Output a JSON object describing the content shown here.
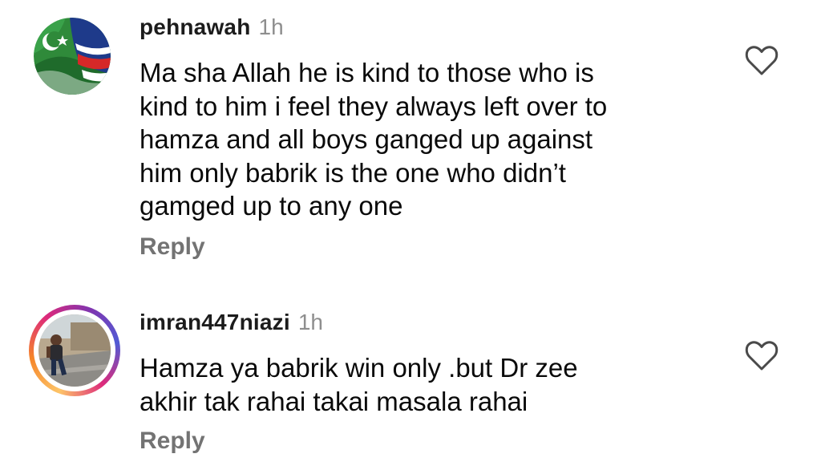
{
  "comments": [
    {
      "username": "pehnawah",
      "time": "1h",
      "text_lines": [
        "Ma sha Allah he is kind to those who is",
        "kind to him i feel they always left over to",
        "hamza and all boys ganged up against",
        "him only babrik is the one who didn’t",
        "gamged up to any one"
      ],
      "reply_label": "Reply",
      "avatar_icon": "flag-avatar-icon",
      "like_icon": "heart-outline-icon"
    },
    {
      "username": "imran447niazi",
      "time": "1h",
      "text_lines": [
        "Hamza ya babrik win only .but Dr zee",
        "akhir tak rahai takai masala rahai"
      ],
      "reply_label": "Reply",
      "avatar_icon": "profile-photo-avatar-icon",
      "like_icon": "heart-outline-icon"
    }
  ],
  "colors": {
    "text": "#0a0a0a",
    "muted": "#8e8e8e",
    "reply": "#737373",
    "story_ring": [
      "#fdc468",
      "#f58529",
      "#dd2a7b",
      "#8134af",
      "#515bd4"
    ]
  }
}
